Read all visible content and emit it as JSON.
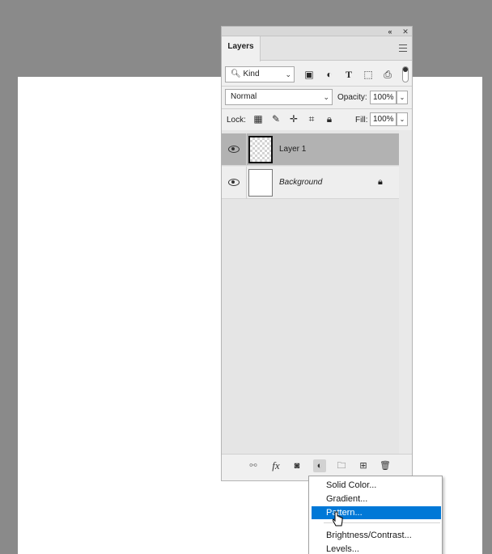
{
  "panel": {
    "collapse_icon": "«",
    "close_icon": "✕",
    "tab_label": "Layers"
  },
  "filter": {
    "kind_label": "Kind",
    "icons": [
      "image-filter-icon",
      "adjustment-filter-icon",
      "type-filter-icon",
      "shape-filter-icon",
      "smart-object-filter-icon"
    ]
  },
  "blend": {
    "mode": "Normal",
    "opacity_label": "Opacity:",
    "opacity_value": "100%"
  },
  "lock": {
    "label": "Lock:",
    "fill_label": "Fill:",
    "fill_value": "100%"
  },
  "layers": [
    {
      "name": "Layer 1",
      "selected": true
    },
    {
      "name": "Background",
      "selected": false,
      "locked": true
    }
  ],
  "menu": {
    "items": [
      "Solid Color...",
      "Gradient...",
      "Pattern...",
      "Brightness/Contrast...",
      "Levels..."
    ],
    "highlighted": "Pattern...",
    "highlight_color": "#0078d7"
  }
}
